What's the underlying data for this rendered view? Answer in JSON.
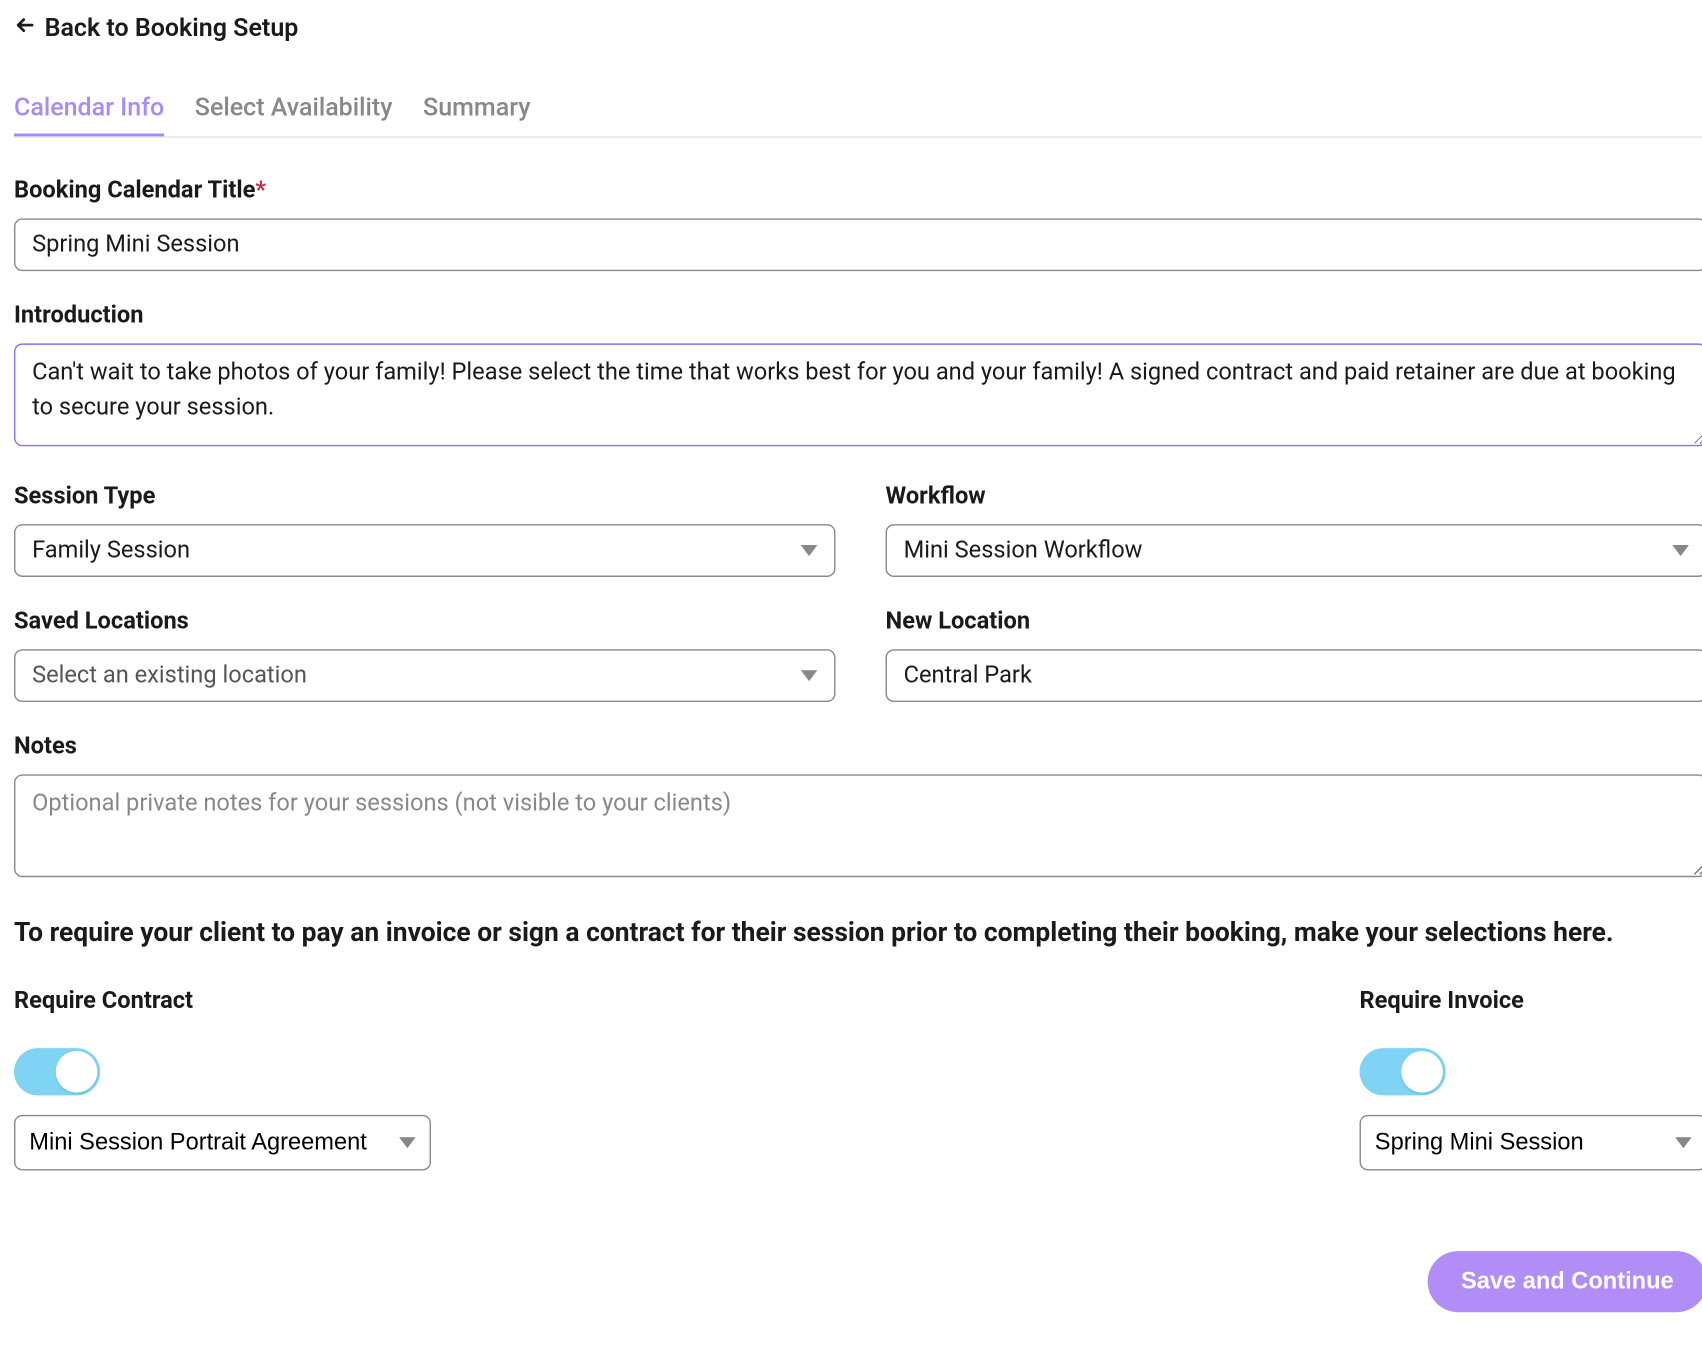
{
  "back_link": "Back to Booking Setup",
  "tabs": {
    "calendar_info": "Calendar Info",
    "select_availability": "Select Availability",
    "summary": "Summary"
  },
  "labels": {
    "title": "Booking Calendar Title",
    "introduction": "Introduction",
    "session_type": "Session Type",
    "workflow": "Workflow",
    "saved_locations": "Saved Locations",
    "new_location": "New Location",
    "notes": "Notes",
    "require_contract": "Require Contract",
    "require_invoice": "Require Invoice"
  },
  "fields": {
    "title_value": "Spring Mini Session",
    "introduction_value": "Can't wait to take photos of your family! Please select the time that works best for you and your family! A signed contract and paid retainer are due at booking to secure your session.",
    "session_type_selected": "Family Session",
    "workflow_selected": "Mini Session Workflow",
    "saved_locations_placeholder": "Select an existing location",
    "new_location_value": "Central Park",
    "notes_placeholder": "Optional private notes for your sessions (not visible to your clients)",
    "contract_selected": "Mini Session Portrait Agreement",
    "invoice_selected": "Spring Mini Session"
  },
  "instruction_text": "To require your client to pay an invoice or sign a contract for their session prior to completing their booking, make your selections here.",
  "buttons": {
    "save": "Save and Continue"
  },
  "toggles": {
    "require_contract": true,
    "require_invoice": true
  }
}
